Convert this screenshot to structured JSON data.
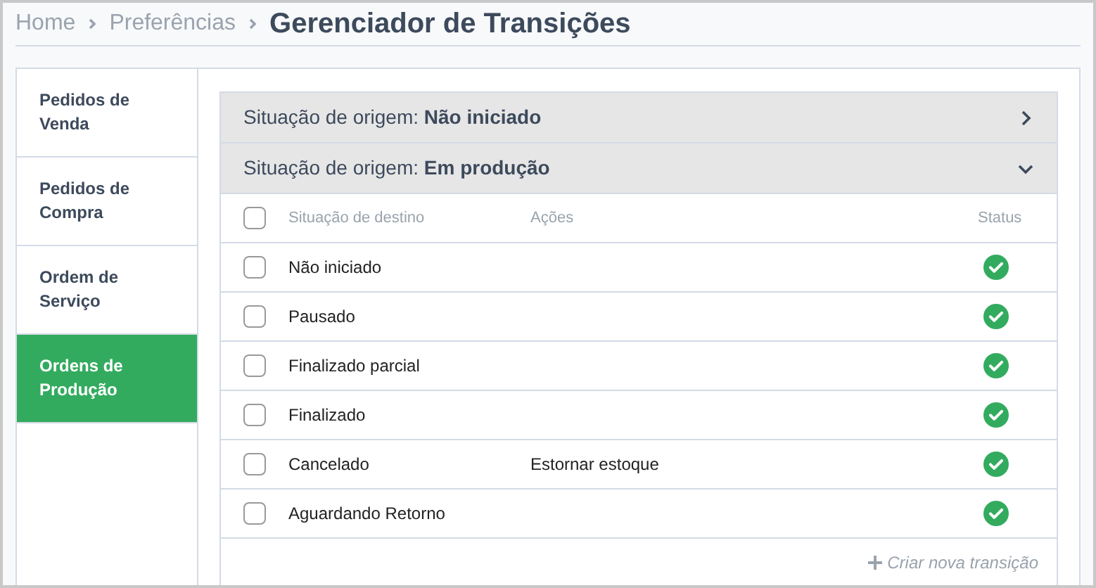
{
  "breadcrumb": {
    "items": [
      "Home",
      "Preferências"
    ],
    "current": "Gerenciador de Transições"
  },
  "sidebar": {
    "items": [
      {
        "label": "Pedidos de Venda",
        "selected": false
      },
      {
        "label": "Pedidos de Compra",
        "selected": false
      },
      {
        "label": "Ordem de Serviço",
        "selected": false
      },
      {
        "label": "Ordens de Produção",
        "selected": true
      }
    ]
  },
  "accordion": [
    {
      "label": "Situação de origem: **Não iniciado**",
      "expanded": false
    },
    {
      "label": "Situação de origem: **Em produção**",
      "expanded": true,
      "table": {
        "select_all": {
          "checked": false
        },
        "columns": [
          "Situação de destino",
          "Ações",
          "Status"
        ],
        "rows": [
          {
            "destination": "Não iniciado",
            "actions": "",
            "checked": false,
            "active": true
          },
          {
            "destination": "Pausado",
            "actions": "",
            "checked": false,
            "active": true
          },
          {
            "destination": "Finalizado parcial",
            "actions": "",
            "checked": false,
            "active": true
          },
          {
            "destination": "Finalizado",
            "actions": "",
            "checked": false,
            "active": true
          },
          {
            "destination": "Cancelado",
            "actions": "Estornar estoque",
            "checked": false,
            "active": true
          },
          {
            "destination": "Aguardando Retorno",
            "actions": "",
            "checked": false,
            "active": true
          }
        ]
      },
      "create_link": "Criar nova transição"
    }
  ]
}
